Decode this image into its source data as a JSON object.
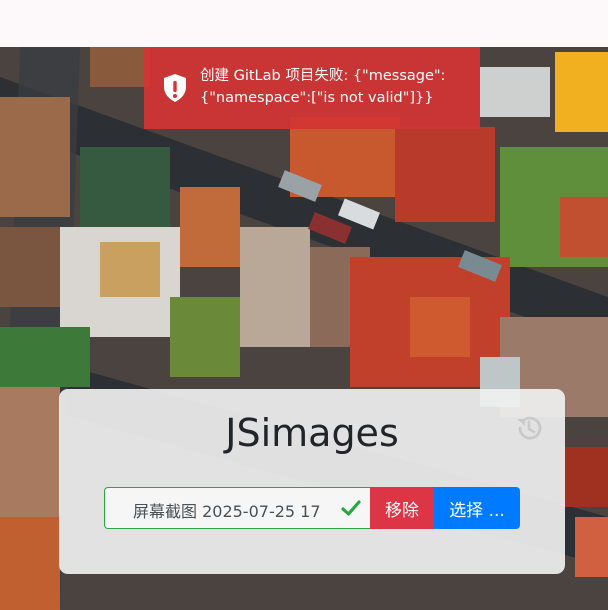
{
  "toast": {
    "message": "创建 GitLab 项目失败: {\"message\":{\"namespace\":[\"is not valid\"]}}",
    "icon": "alert-shield-icon",
    "color": "#d43434"
  },
  "app": {
    "title": "JSimages",
    "history_icon": "history-icon"
  },
  "upload": {
    "file_name": "屏幕截图 2025-07-25 17",
    "status_icon": "check-icon",
    "remove_label": "移除",
    "choose_label": "选择 ...",
    "colors": {
      "valid": "#28a745",
      "remove": "#dc3545",
      "choose": "#007bff"
    }
  }
}
